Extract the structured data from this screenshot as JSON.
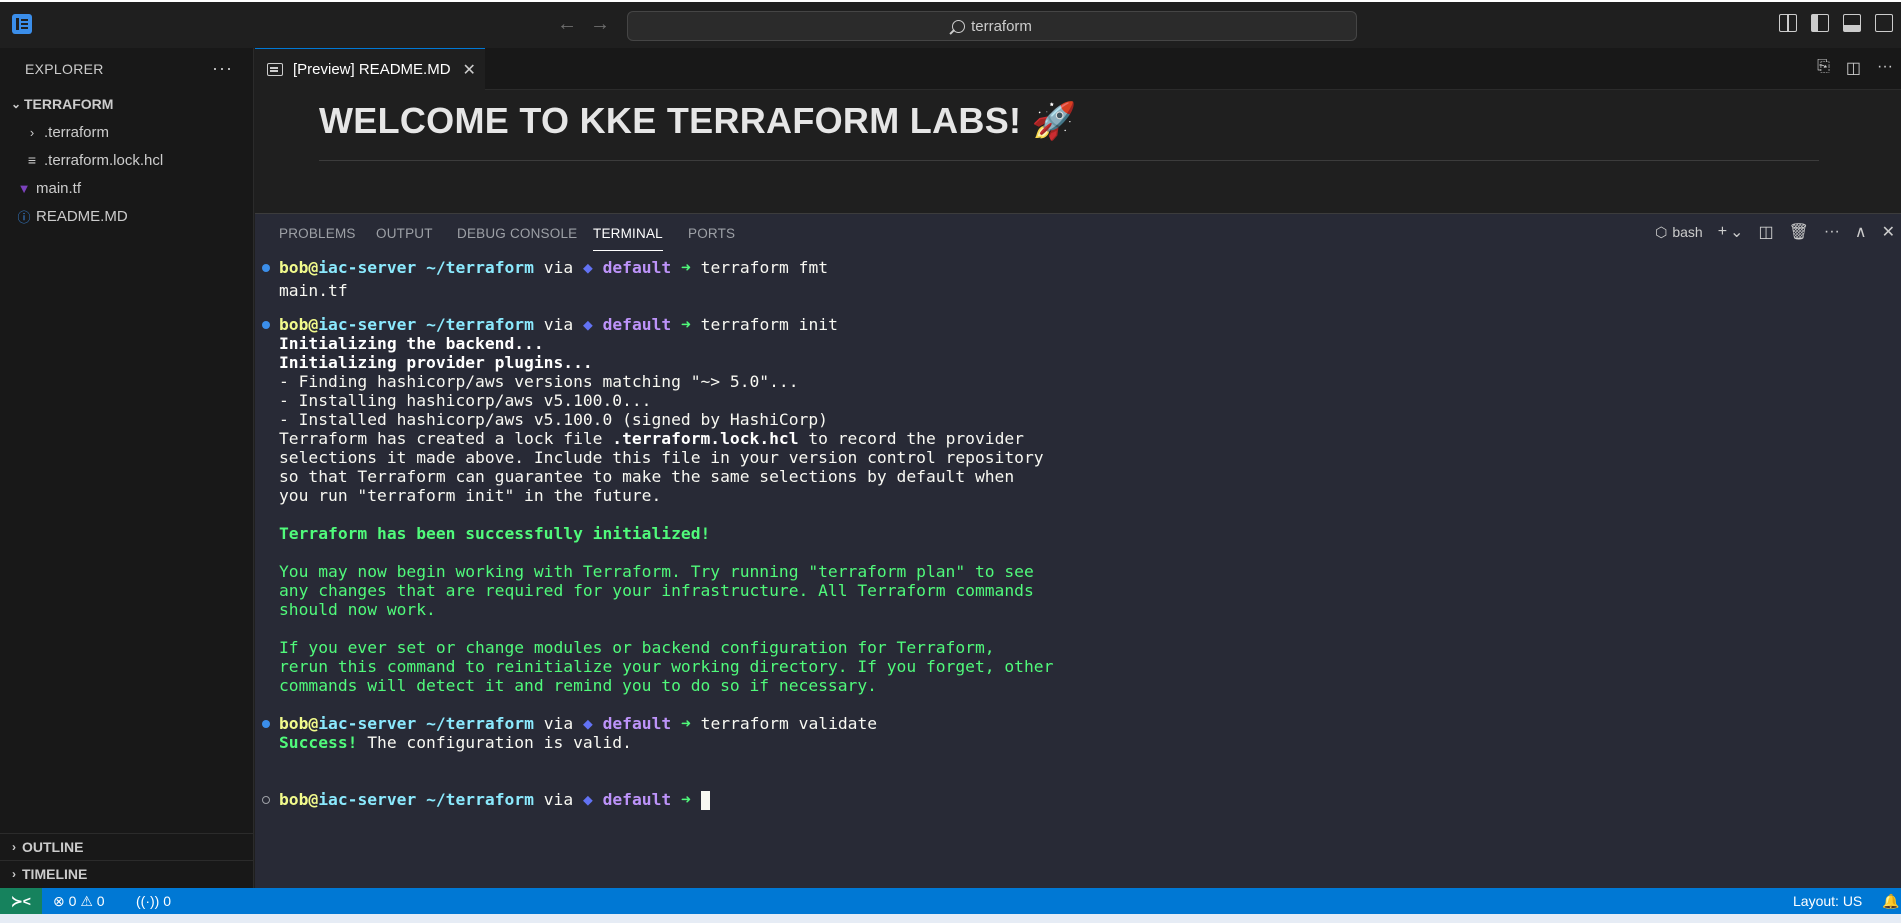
{
  "titlebar": {
    "search_text": "terraform",
    "icons": [
      "app-icon",
      "back-arrow-icon",
      "forward-arrow-icon",
      "search-icon",
      "customize-layout-icon",
      "toggle-primary-sidebar-icon",
      "toggle-panel-icon",
      "toggle-secondary-sidebar-icon"
    ],
    "back_glyph": "←",
    "forward_glyph": "→"
  },
  "sidebar": {
    "title": "EXPLORER",
    "more": "···",
    "root": "TERRAFORM",
    "items": [
      {
        "label": ".terraform",
        "icon": "chevron-right-icon",
        "glyph": "›"
      },
      {
        "label": ".terraform.lock.hcl",
        "icon": "file-lines-icon",
        "glyph": "≡"
      },
      {
        "label": "main.tf",
        "icon": "terraform-icon",
        "glyph": "▼"
      },
      {
        "label": "README.MD",
        "icon": "info-icon",
        "glyph": "ⓘ"
      }
    ],
    "outline": "OUTLINE",
    "timeline": "TIMELINE"
  },
  "editor": {
    "tab_label": "[Preview] README.MD",
    "tab_close": "✕",
    "preview_heading": "WELCOME TO KKE TERRAFORM LABS! 🚀",
    "actions": [
      "open-source-icon",
      "split-editor-icon",
      "more-actions-icon"
    ]
  },
  "panel": {
    "tabs": [
      "PROBLEMS",
      "OUTPUT",
      "DEBUG CONSOLE",
      "TERMINAL",
      "PORTS"
    ],
    "active_tab": "TERMINAL",
    "shell": "bash",
    "actions": {
      "add": "+",
      "dropdown": "⌄",
      "split": "◫",
      "trash": "🗑",
      "more": "···",
      "maximize": "∧",
      "close": "✕"
    }
  },
  "prompt": {
    "user": "bob",
    "at": "@",
    "host": "iac-server",
    "path": "~/terraform",
    "via": "via",
    "diamond": "◆",
    "workspace": "default",
    "arrow": "➜"
  },
  "terminal": {
    "cmd1": "terraform fmt",
    "out1": "main.tf",
    "cmd2": "terraform init",
    "init_lines": [
      "Initializing the backend...",
      "Initializing provider plugins...",
      "- Finding hashicorp/aws versions matching \"~> 5.0\"...",
      "- Installing hashicorp/aws v5.100.0...",
      "- Installed hashicorp/aws v5.100.0 (signed by HashiCorp)"
    ],
    "lock_pre": "Terraform has created a lock file ",
    "lock_file": ".terraform.lock.hcl",
    "lock_post": " to record the provider",
    "lock_lines": [
      "selections it made above. Include this file in your version control repository",
      "so that Terraform can guarantee to make the same selections by default when",
      "you run \"terraform init\" in the future."
    ],
    "success_init": "Terraform has been successfully initialized!",
    "green_para1": [
      "You may now begin working with Terraform. Try running \"terraform plan\" to see",
      "any changes that are required for your infrastructure. All Terraform commands",
      "should now work."
    ],
    "green_para2": [
      "If you ever set or change modules or backend configuration for Terraform,",
      "rerun this command to reinitialize your working directory. If you forget, other",
      "commands will detect it and remind you to do so if necessary."
    ],
    "cmd3": "terraform validate",
    "validate_success": "Success!",
    "validate_rest": " The configuration is valid."
  },
  "statusbar": {
    "remote_glyph": "≻<",
    "errors": "0",
    "warnings": "0",
    "ports": "0",
    "layout": "Layout: US",
    "error_glyph": "⊗",
    "warning_glyph": "⚠",
    "ports_glyph": "((·))",
    "bell_glyph": "🔔"
  },
  "colors": {
    "accent": "#0078d4",
    "terminal_bg": "#282a36",
    "sidebar_bg": "#181818",
    "success_green": "#50fa7b"
  }
}
